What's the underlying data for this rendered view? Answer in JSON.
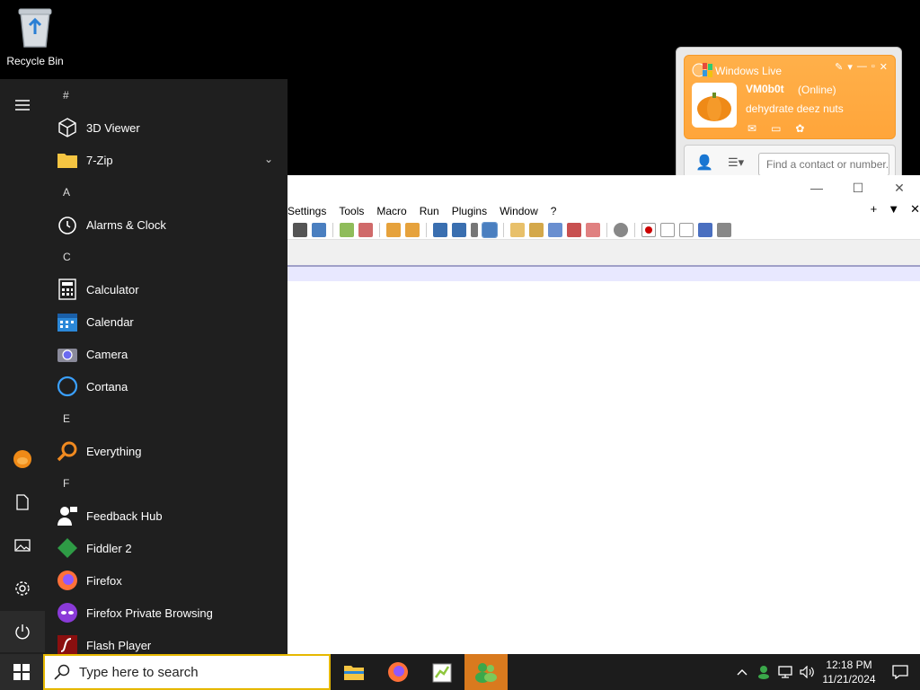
{
  "desktop": {
    "recycle_bin_label": "Recycle Bin"
  },
  "notepad": {
    "menu": [
      "Settings",
      "Tools",
      "Macro",
      "Run",
      "Plugins",
      "Window",
      "?"
    ],
    "tab_ctrls": {
      "add": "+",
      "list": "▼",
      "close": "✕"
    },
    "window_ctrls": {
      "minimize": "—",
      "maximize": "☐",
      "close": "✕"
    }
  },
  "messenger": {
    "title": "Windows Live",
    "username": "VM0b0t",
    "status": "(Online)",
    "personal_message": "dehydrate deez nuts",
    "search_placeholder": "Find a contact or number..."
  },
  "start_menu": {
    "sections": [
      {
        "letter": "#",
        "apps": [
          "3D Viewer",
          "7-Zip"
        ]
      },
      {
        "letter": "A",
        "apps": [
          "Alarms & Clock"
        ]
      },
      {
        "letter": "C",
        "apps": [
          "Calculator",
          "Calendar",
          "Camera",
          "Cortana"
        ]
      },
      {
        "letter": "E",
        "apps": [
          "Everything"
        ]
      },
      {
        "letter": "F",
        "apps": [
          "Feedback Hub",
          "Fiddler 2",
          "Firefox",
          "Firefox Private Browsing",
          "Flash Player"
        ]
      }
    ]
  },
  "taskbar": {
    "search_placeholder": "Type here to search",
    "time": "12:18 PM",
    "date": "11/21/2024"
  },
  "colors": {
    "accent_orange": "#d97a1e",
    "search_border": "#e6b800",
    "start_bg": "#1f1f1f"
  }
}
